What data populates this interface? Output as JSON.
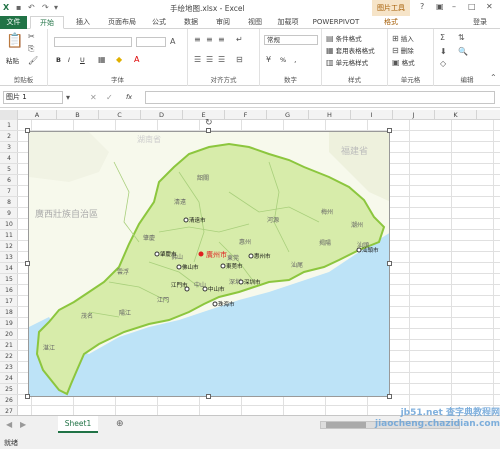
{
  "title_bar": {
    "title": "手绘地图.xlsx - Excel",
    "context_group": "图片工具",
    "user": "登录"
  },
  "tabs": [
    "开始",
    "插入",
    "页面布局",
    "公式",
    "数据",
    "审阅",
    "视图",
    "加载项",
    "POWERPIVOT",
    "格式"
  ],
  "file_tab": "文件",
  "ribbon": {
    "clipboard": {
      "paste": "粘贴",
      "group": "剪贴板"
    },
    "font": {
      "group": "字体",
      "bold": "B",
      "italic": "I",
      "underline": "U"
    },
    "alignment": {
      "group": "对齐方式"
    },
    "number": {
      "format": "常规",
      "group": "数字",
      "percent": "%"
    },
    "styles": {
      "conditional": "条件格式",
      "table": "套用表格格式",
      "cell": "单元格样式",
      "group": "样式"
    },
    "cells": {
      "insert": "插入",
      "delete": "删除",
      "format": "格式",
      "group": "单元格"
    },
    "editing": {
      "group": "编辑"
    }
  },
  "formula_bar": {
    "name_box": "图片 1",
    "fx": "fx",
    "formula": ""
  },
  "columns": [
    "A",
    "B",
    "C",
    "D",
    "E",
    "F",
    "G",
    "H",
    "I",
    "J",
    "K"
  ],
  "rows": [
    "1",
    "2",
    "3",
    "4",
    "5",
    "6",
    "7",
    "8",
    "9",
    "10",
    "11",
    "12",
    "13",
    "14",
    "15",
    "16",
    "17",
    "18",
    "19",
    "20",
    "21",
    "22",
    "23",
    "24",
    "25",
    "26",
    "27"
  ],
  "map": {
    "regions": [
      "湖南省",
      "福建省",
      "廣西壯族自治區"
    ],
    "cities": [
      "韶關",
      "清遠",
      "河源",
      "梅州",
      "潮州",
      "肇慶",
      "揭陽",
      "汕頭",
      "雲浮",
      "佛山",
      "惠州",
      "汕尾",
      "江門",
      "茂名",
      "陽江",
      "湛江",
      "中山",
      "東莞",
      "深圳"
    ],
    "capital": "廣州市",
    "markers": [
      "清遠市",
      "肇慶市",
      "佛山市",
      "東莞市",
      "惠州市",
      "汕頭市",
      "江門市",
      "中山市",
      "深圳市",
      "珠海市"
    ],
    "colors": {
      "land": "#d7ecaa",
      "sea": "#bde3f7",
      "border": "#8cc63e",
      "capital": "#e02020"
    }
  },
  "sheet_tabs": [
    "Sheet1"
  ],
  "status": {
    "ready": "就绪"
  },
  "watermark": "jb51.net 查字典教程网 jiaocheng.chazidian.com"
}
